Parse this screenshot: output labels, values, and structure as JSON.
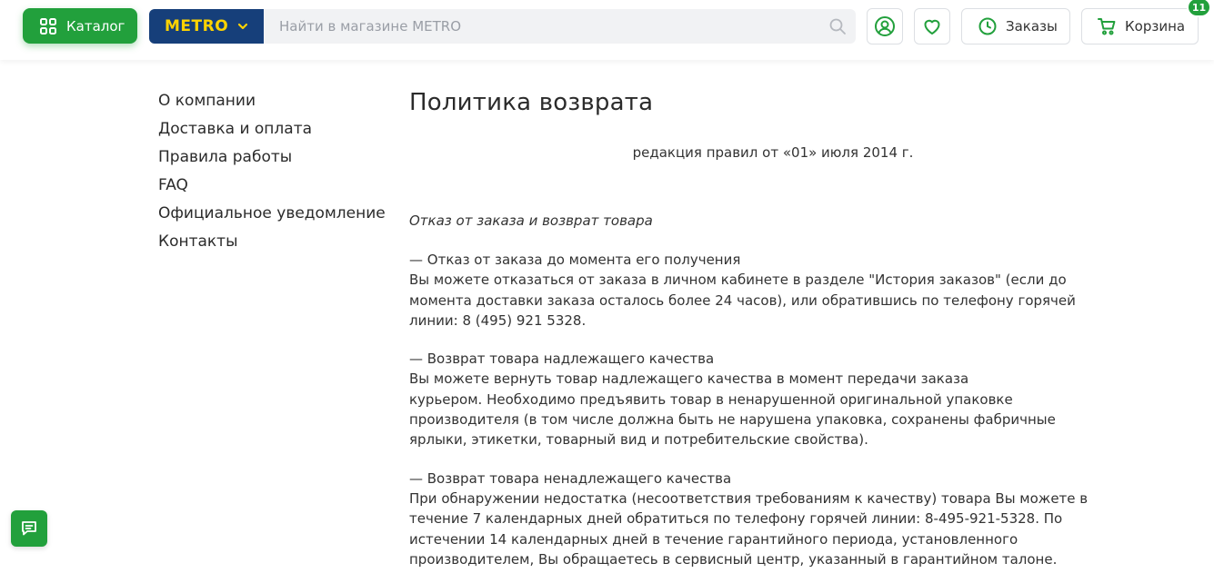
{
  "header": {
    "catalog_label": "Каталог",
    "store_logo": "METRO",
    "search_placeholder": "Найти в магазине METRO",
    "orders_label": "Заказы",
    "cart_label": "Корзина",
    "cart_count": "11",
    "icons": {
      "catalog": "grid-icon",
      "store": "chevron-down-icon",
      "search": "search-icon",
      "profile": "user-icon",
      "favorites": "heart-icon",
      "orders": "clock-icon",
      "cart": "cart-icon",
      "chat": "chat-icon"
    },
    "colors": {
      "accent": "#22a03c",
      "brand_blue": "#163f7a",
      "brand_yellow": "#ffd300"
    }
  },
  "sidebar": {
    "items": [
      {
        "label": "О компании"
      },
      {
        "label": "Доставка и оплата"
      },
      {
        "label": "Правила работы"
      },
      {
        "label": "FAQ"
      },
      {
        "label": "Официальное уведомление"
      },
      {
        "label": "Контакты"
      }
    ]
  },
  "main": {
    "title": "Политика возврата",
    "edition": "редакция правил от «01» июля 2014 г.",
    "section_title": "Отказ от заказа и возврат товара",
    "paragraphs": [
      {
        "lines": [
          "— Отказ от заказа до момента его получения",
          "Вы можете отказаться от заказа в личном кабинете в разделе \"История заказов\" (если до",
          "момента доставки заказа осталось более 24 часов), или обратившись по телефону горячей",
          "линии: 8 (495) 921 5328."
        ]
      },
      {
        "lines": [
          "— Возврат товара надлежащего качества",
          "Вы можете вернуть товар надлежащего качества в момент передачи заказа",
          "курьером. Необходимо предъявить товар в ненарушенной оригинальной упаковке",
          "производителя (в том числе должна быть не нарушена упаковка, сохранены фабричные",
          "ярлыки, этикетки, товарный вид и потребительские свойства)."
        ]
      },
      {
        "lines": [
          "— Возврат товара ненадлежащего качества",
          "При обнаружении недостатка (несоответствия требованиям к качеству) товара Вы можете в",
          "течение 7 календарных дней обратиться по телефону горячей линии: 8-495-921-5328. По",
          "истечении 14 календарных дней в течение гарантийного периода, установленного",
          "производителем, Вы обращаетесь в сервисный центр, указанный в гарантийном талоне."
        ]
      }
    ]
  }
}
